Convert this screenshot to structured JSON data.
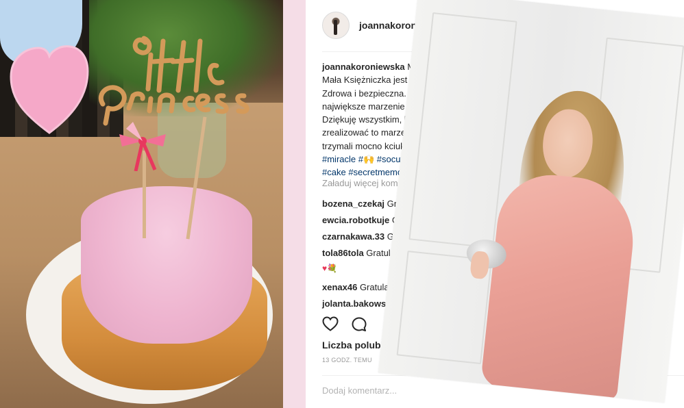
{
  "post": {
    "username": "joannakoroniewska",
    "caption_lines": [
      {
        "user": "joannakoroniewska",
        "text": " Marze"
      },
      {
        "text": "Mała Księżniczka jest już ."
      },
      {
        "text": "Zdrowa i bezpieczna. Spe"
      },
      {
        "text": "największe marzenie swo"
      },
      {
        "text": "Dziękuję wszystkim, któ"
      },
      {
        "text": "zrealizować to marzenie"
      },
      {
        "text": "trzymali mocno kciuki. ."
      }
    ],
    "hashtag_line1": {
      "t1": "#miracle",
      "t2": "#🙌",
      "t3": "#socute",
      "t4": "#"
    },
    "hashtag_line2": {
      "t1": "#cake",
      "t2": "#secretmemorie"
    },
    "load_more": "Załaduj więcej komen",
    "comments": [
      {
        "user": "bozena_czekaj",
        "text": " Grat"
      },
      {
        "user": "ewcia.robotkuje",
        "text": " Gra"
      },
      {
        "user": "czarnakawa.33",
        "text": " Gr"
      },
      {
        "user": "tola86tola",
        "text": " Gratula"
      }
    ],
    "comment_emoji": {
      "heart": "♥",
      "bouquet": "💐"
    },
    "comments2": [
      {
        "user": "xenax46",
        "text": " Gratula"
      },
      {
        "user": "jolanta.bakows!",
        "text": ""
      }
    ],
    "likes": "Liczba polubie",
    "time": "13 GODZ. TEMU",
    "add_comment_placeholder": "Dodaj komentarz..."
  },
  "icons": {
    "like": "heart-icon",
    "comment": "comment-icon"
  },
  "colors": {
    "username": "#262626",
    "hashtag": "#003569",
    "muted": "#999999",
    "panel_pink": "#f5dde7",
    "dress": "#eaa096",
    "cake_pink": "#eeb4cf"
  }
}
